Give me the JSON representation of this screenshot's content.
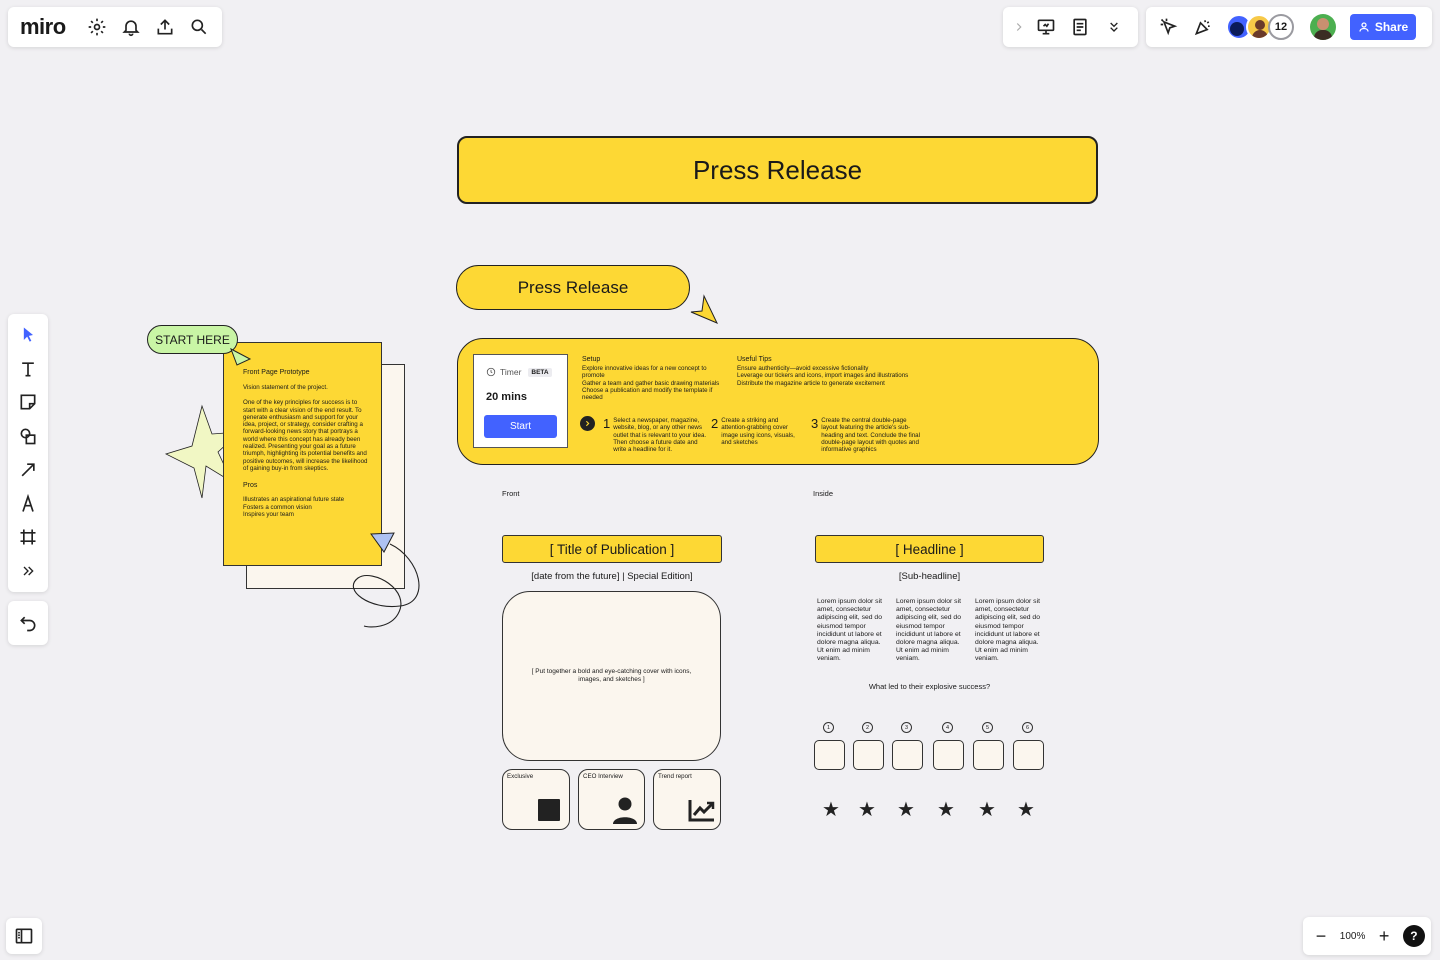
{
  "app": {
    "logo": "miro"
  },
  "topbar": {
    "avatar_count": "12",
    "share_label": "Share"
  },
  "zoom": {
    "level": "100%",
    "help": "?"
  },
  "board": {
    "main_title": "Press Release",
    "sub_title": "Press Release",
    "start_here": "START HERE",
    "timer": {
      "label": "Timer",
      "badge": "BETA",
      "duration": "20 mins",
      "start_button": "Start"
    },
    "setup": {
      "heading": "Setup",
      "lines": [
        "Explore innovative ideas for a new concept to promote",
        "Gather a team and gather basic drawing materials",
        "Choose a publication and modify the template if needed"
      ]
    },
    "tips": {
      "heading": "Useful Tips",
      "lines": [
        "Ensure authenticity—avoid excessive fictionality",
        "Leverage our tickers and icons, import images and illustrations",
        "Distribute the magazine article to generate excitement"
      ]
    },
    "steps": [
      {
        "num": "1",
        "text": "Select a newspaper, magazine, website, blog, or any other news outlet that is relevant to your idea. Then choose a future date and write a headline for it."
      },
      {
        "num": "2",
        "text": "Create a striking and attention-grabbing cover image using icons, visuals, and sketches"
      },
      {
        "num": "3",
        "text": "Create the central double-page layout featuring the article's sub-heading and text. Conclude the final double-page layout with quotes and informative graphics"
      }
    ],
    "note": {
      "title": "Front Page Prototype",
      "vision": "Vision statement of the project.",
      "body": "One of the key principles for success is to start with a clear vision of the end result. To generate enthusiasm and support for your idea, project, or strategy, consider crafting a forward-looking news story that portrays a world where this concept has already been realized. Presenting your goal as a future triumph, highlighting its potential benefits and positive outcomes, will increase the likelihood of gaining buy-in from skeptics.",
      "pros_heading": "Pros",
      "pros": [
        "Illustrates an aspirational future state",
        "Fosters a common vision",
        "Inspires your team"
      ]
    },
    "front": {
      "label": "Front",
      "title": "[ Title of Publication ]",
      "date_line": "[date from the future] | Special Edition]",
      "cover_text": "[ Put together a bold and eye-catching cover with icons, images, and sketches ]",
      "cards": [
        "Exclusive",
        "CEO Interview",
        "Trend report"
      ]
    },
    "inside": {
      "label": "Inside",
      "headline": "[ Headline ]",
      "subheadline": "[Sub-headline]",
      "lorem": "Lorem ipsum dolor sit amet, consectetur adipiscing elit, sed do eiusmod tempor incididunt ut labore et dolore magna aliqua. Ut enim ad minim veniam.",
      "question": "What led to their explosive success?",
      "numbers": [
        "1",
        "2",
        "3",
        "4",
        "5",
        "6"
      ]
    }
  },
  "colors": {
    "yellow": "#fdd834",
    "cream": "#fbf6ee",
    "accent_blue": "#4262ff",
    "start_green": "#c9f5a5"
  },
  "icons": {
    "toolbar_left": [
      "settings-icon",
      "bell-icon",
      "upload-icon",
      "search-icon"
    ],
    "tools": [
      "select-icon",
      "text-icon",
      "sticky-note-icon",
      "shapes-icon",
      "arrow-icon",
      "pen-icon",
      "frame-icon",
      "more-tools-icon",
      "undo-icon"
    ]
  }
}
